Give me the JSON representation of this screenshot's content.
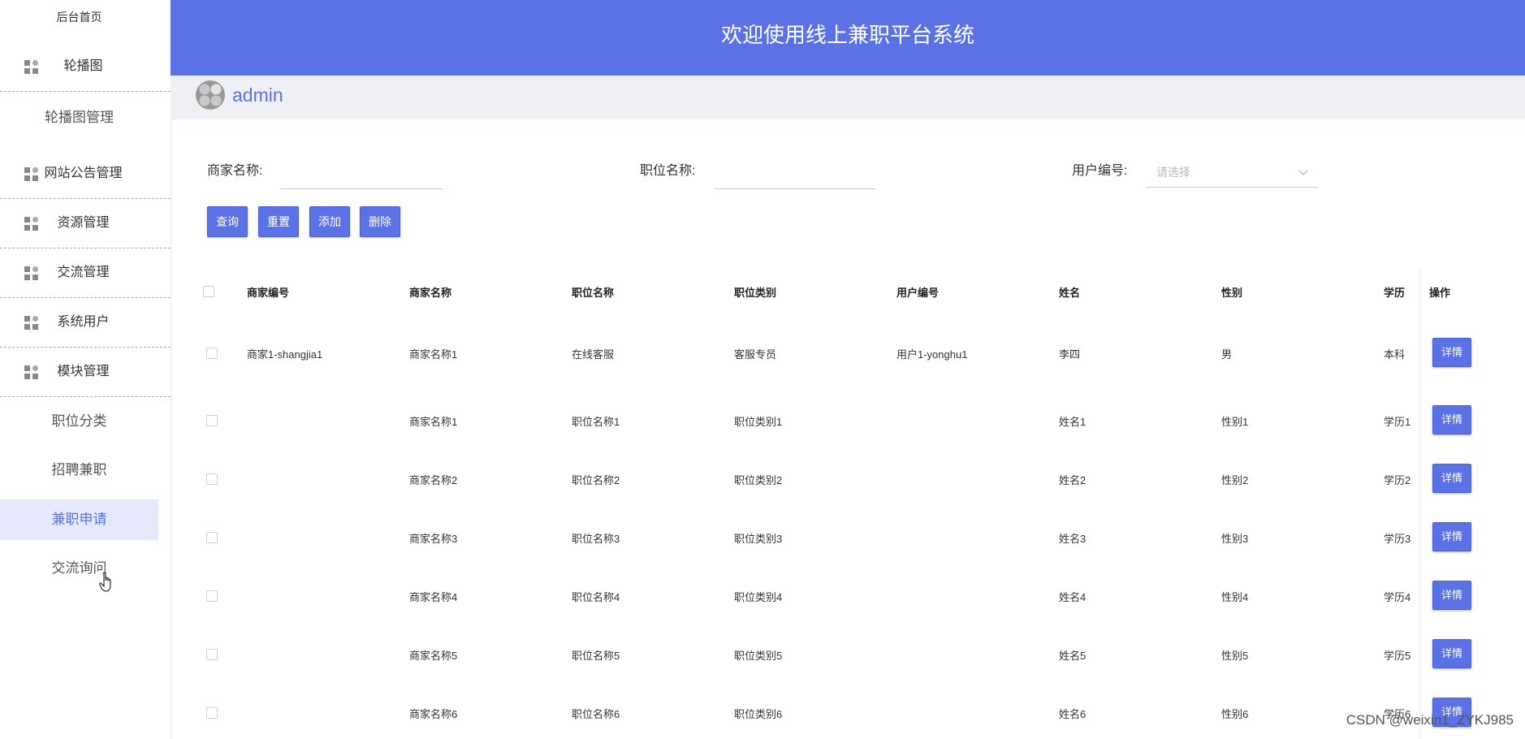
{
  "sidebar": {
    "home": "后台首页",
    "groups": [
      {
        "label": "轮播图",
        "icon": "grid-icon"
      },
      {
        "label": "网站公告管理",
        "icon": "grid-icon"
      },
      {
        "label": "资源管理",
        "icon": "grid-icon"
      },
      {
        "label": "交流管理",
        "icon": "grid-icon"
      },
      {
        "label": "系统用户",
        "icon": "grid-icon"
      },
      {
        "label": "模块管理",
        "icon": "grid-icon"
      }
    ],
    "carousel_sub": "轮播图管理",
    "module_sub": [
      "职位分类",
      "招聘兼职",
      "兼职申请",
      "交流询问"
    ],
    "active": "兼职申请"
  },
  "header": {
    "title": "欢迎使用线上兼职平台系统"
  },
  "user": {
    "name": "admin"
  },
  "search": {
    "merchant_label": "商家名称:",
    "position_label": "职位名称:",
    "user_label": "用户编号:",
    "user_placeholder": "请选择",
    "merchant_value": "",
    "position_value": ""
  },
  "buttons": {
    "query": "查询",
    "reset": "重置",
    "add": "添加",
    "delete": "删除"
  },
  "table": {
    "headers": [
      "商家编号",
      "商家名称",
      "职位名称",
      "职位类别",
      "用户编号",
      "姓名",
      "性别",
      "学历",
      "操作"
    ],
    "rows": [
      [
        "商家1-shangjia1",
        "商家名称1",
        "在线客服",
        "客服专员",
        "用户1-yonghu1",
        "李四",
        "男",
        "本科"
      ],
      [
        "",
        "商家名称1",
        "职位名称1",
        "职位类别1",
        "",
        "姓名1",
        "性别1",
        "学历1"
      ],
      [
        "",
        "商家名称2",
        "职位名称2",
        "职位类别2",
        "",
        "姓名2",
        "性别2",
        "学历2"
      ],
      [
        "",
        "商家名称3",
        "职位名称3",
        "职位类别3",
        "",
        "姓名3",
        "性别3",
        "学历3"
      ],
      [
        "",
        "商家名称4",
        "职位名称4",
        "职位类别4",
        "",
        "姓名4",
        "性别4",
        "学历4"
      ],
      [
        "",
        "商家名称5",
        "职位名称5",
        "职位类别5",
        "",
        "姓名5",
        "性别5",
        "学历5"
      ],
      [
        "",
        "商家名称6",
        "职位名称6",
        "职位类别6",
        "",
        "姓名6",
        "性别6",
        "学历6"
      ]
    ],
    "detail_label": "详情"
  },
  "watermark": "CSDN @weixin1_ZYKJ985",
  "colors": {
    "primary": "#5a72e6",
    "active_bg": "#e5e9fb",
    "userbar_bg": "#eff0f4"
  }
}
